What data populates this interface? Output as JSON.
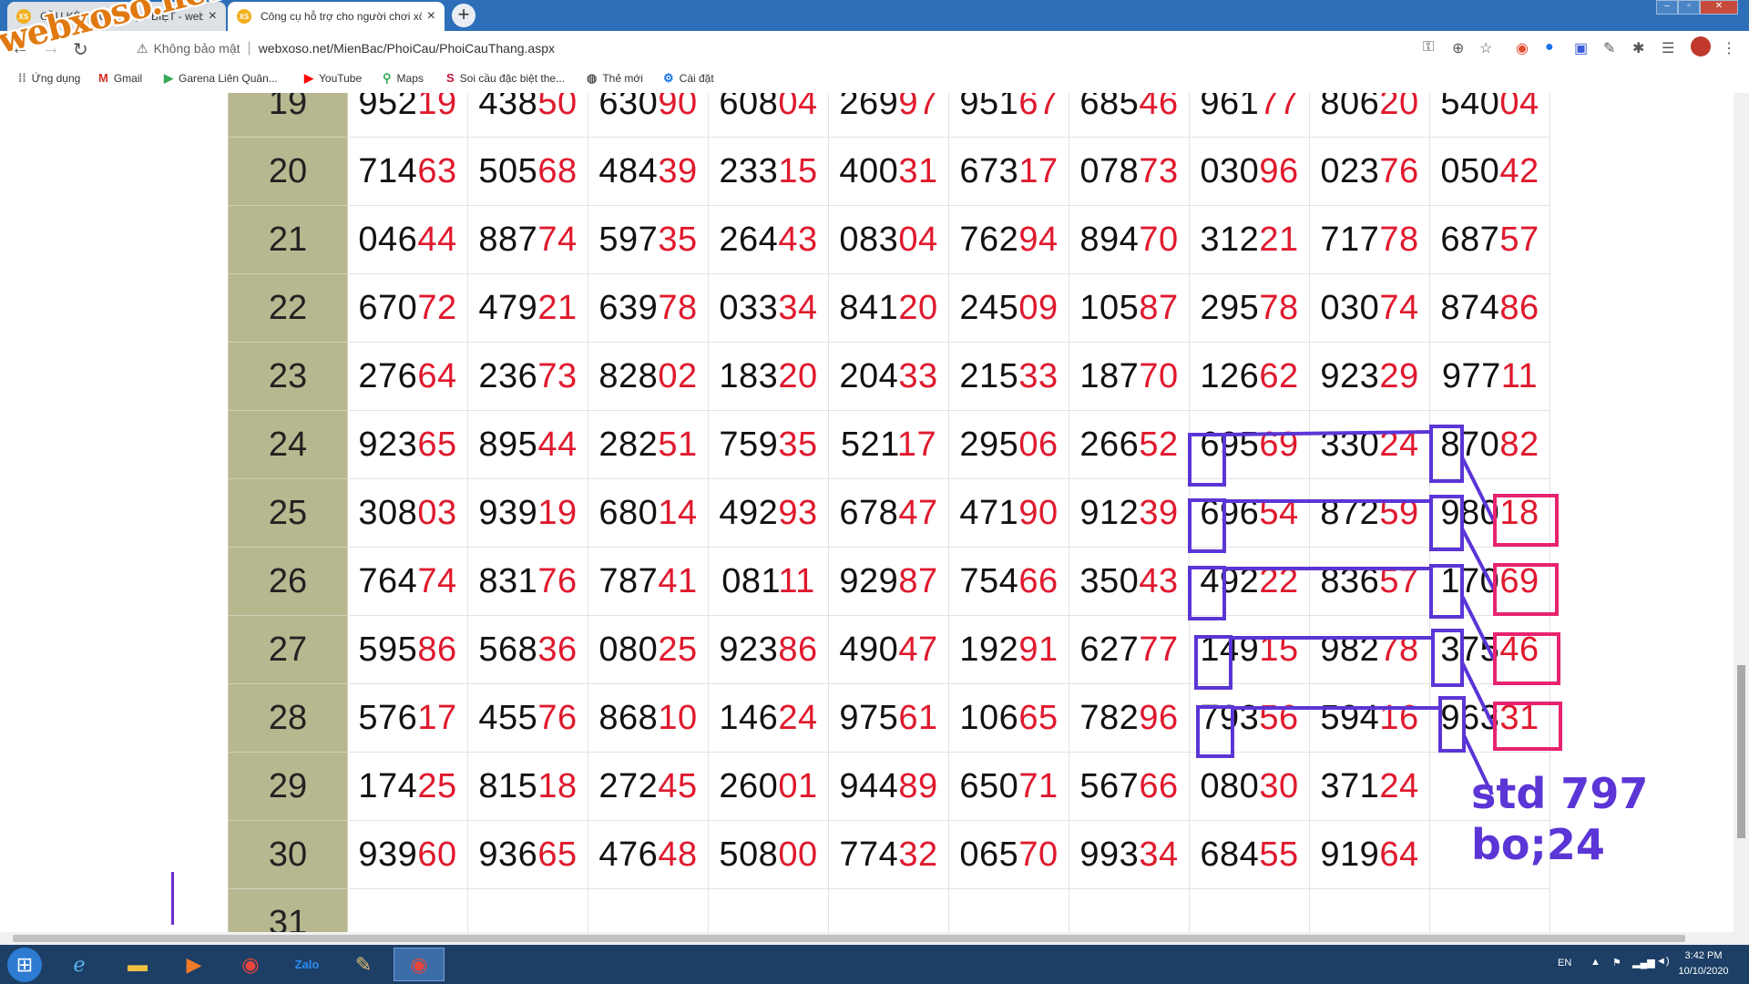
{
  "browser": {
    "tabs": [
      {
        "favicon": "XS",
        "title": "CẦU KÈO - CẦU ĐẶC BIỆT - webxoso",
        "close": "×",
        "active": false
      },
      {
        "favicon": "XS",
        "title": "Công cụ hỗ trợ cho người chơi xổ số",
        "close": "×",
        "active": true
      }
    ],
    "new_tab": "+",
    "security_label": "Không bảo mật",
    "url": "webxoso.net/MienBac/PhoiCau/PhoiCauThang.aspx",
    "bookmarks": [
      "Ứng dụng",
      "Gmail",
      "Garena Liên Quân...",
      "YouTube",
      "Maps",
      "Soi cầu đặc biệt the...",
      "Thẻ mới",
      "Cài đặt"
    ]
  },
  "watermark": "webxoso.net",
  "table": {
    "rows": [
      {
        "day": "19",
        "values": [
          "95219",
          "43850",
          "63090",
          "60804",
          "26997",
          "95167",
          "68546",
          "96177",
          "80620",
          "54004"
        ]
      },
      {
        "day": "20",
        "values": [
          "71463",
          "50568",
          "48439",
          "23315",
          "40031",
          "67317",
          "07873",
          "03096",
          "02376",
          "05042"
        ]
      },
      {
        "day": "21",
        "values": [
          "04644",
          "88774",
          "59735",
          "26443",
          "08304",
          "76294",
          "89470",
          "31221",
          "71778",
          "68757"
        ]
      },
      {
        "day": "22",
        "values": [
          "67072",
          "47921",
          "63978",
          "03334",
          "84120",
          "24509",
          "10587",
          "29578",
          "03074",
          "87486"
        ]
      },
      {
        "day": "23",
        "values": [
          "27664",
          "23673",
          "82802",
          "18320",
          "20433",
          "21533",
          "18770",
          "12662",
          "92329",
          "97711"
        ]
      },
      {
        "day": "24",
        "values": [
          "92365",
          "89544",
          "28251",
          "75935",
          "52117",
          "29506",
          "26652",
          "69569",
          "33024",
          "87082"
        ]
      },
      {
        "day": "25",
        "values": [
          "30803",
          "93919",
          "68014",
          "49293",
          "67847",
          "47190",
          "91239",
          "69654",
          "87259",
          "98018"
        ]
      },
      {
        "day": "26",
        "values": [
          "76474",
          "83176",
          "78741",
          "08111",
          "92987",
          "75466",
          "35043",
          "49222",
          "83657",
          "17069"
        ]
      },
      {
        "day": "27",
        "values": [
          "59586",
          "56836",
          "08025",
          "92386",
          "49047",
          "19291",
          "62777",
          "14915",
          "98278",
          "37546"
        ]
      },
      {
        "day": "28",
        "values": [
          "57617",
          "45576",
          "86810",
          "14624",
          "97561",
          "10665",
          "78296",
          "79356",
          "59416",
          "96331"
        ]
      },
      {
        "day": "29",
        "values": [
          "17425",
          "81518",
          "27245",
          "26001",
          "94489",
          "65071",
          "56766",
          "08030",
          "37124",
          ""
        ]
      },
      {
        "day": "30",
        "values": [
          "93960",
          "93665",
          "47648",
          "50800",
          "77432",
          "06570",
          "99334",
          "68455",
          "91964",
          ""
        ]
      },
      {
        "day": "31",
        "values": [
          "",
          "",
          "",
          "",
          "",
          "",
          "",
          "",
          "",
          ""
        ]
      }
    ]
  },
  "annotation": {
    "line1": "std 797",
    "line2": "bo;24",
    "box_color_blue": "#5b35d6",
    "box_color_pink": "#e8236f"
  },
  "taskbar": {
    "apps": [
      "Internet Explorer",
      "File Explorer",
      "Media Player",
      "Chrome",
      "Zalo",
      "Paint",
      "Chrome (active)"
    ],
    "language": "EN",
    "time": "3:42 PM",
    "date": "10/10/2020"
  },
  "colors": {
    "tail_digits": "#e0192d",
    "day_column": "#b8b890",
    "tab_strip": "#2d70b9",
    "taskbar": "#1d3f66"
  }
}
